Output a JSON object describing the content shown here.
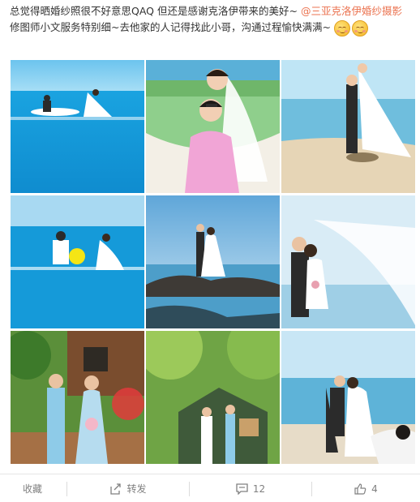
{
  "post": {
    "text_before": "总觉得晒婚纱照很不好意思QAQ 但还是感谢克洛伊带来的美好~ ",
    "mention": "@三亚克洛伊婚纱摄影",
    "text_after": " 修图师小文服务特别细~去他家的人记得找此小哥，沟通过程愉快满满~",
    "emoji_icons": [
      "blush-emoji-icon",
      "blush-emoji-icon"
    ]
  },
  "photos": [
    "photo-infinity-pool-couple",
    "photo-hammock-couple",
    "photo-beach-lift-couple",
    "photo-pool-splash-couple",
    "photo-rocky-shore-couple",
    "photo-veil-kiss-couple",
    "photo-garden-couple",
    "photo-cabin-couple",
    "photo-beach-embrace-couple"
  ],
  "actions": {
    "favorite_label": "收藏",
    "repost_label": "转发",
    "comment_count": "12",
    "like_count": "4"
  },
  "colors": {
    "mention": "#eb7350",
    "text": "#333333",
    "muted": "#808080"
  }
}
